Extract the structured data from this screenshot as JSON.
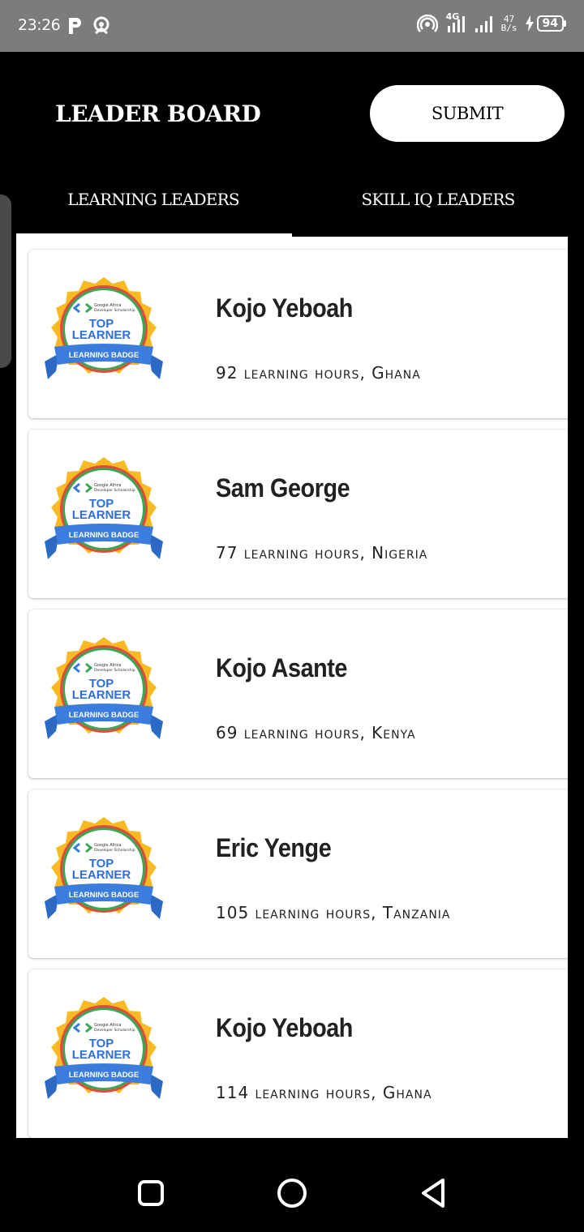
{
  "status_bar": {
    "time": "23:26",
    "net_speed_top": "47",
    "net_speed_bottom": "B/s",
    "network_label": "4G",
    "battery": "94"
  },
  "header": {
    "title": "LEADER BOARD",
    "submit_label": "SUBMIT"
  },
  "tabs": [
    {
      "label": "LEARNING LEADERS",
      "selected": true
    },
    {
      "label": "SKILL IQ LEADERS",
      "selected": false
    }
  ],
  "badge": {
    "brand_line1": "Google Africa",
    "brand_line2": "Developer Scholarship",
    "title_line1": "TOP",
    "title_line2": "LEARNER",
    "ribbon": "LEARNING BADGE"
  },
  "leaders": [
    {
      "name": "Kojo Yeboah",
      "detail": "92 learning hours, Ghana"
    },
    {
      "name": "Sam George",
      "detail": "77 learning hours, Nigeria"
    },
    {
      "name": "Kojo Asante",
      "detail": "69 learning hours, Kenya"
    },
    {
      "name": "Eric Yenge",
      "detail": "105 learning hours, Tanzania"
    },
    {
      "name": "Kojo Yeboah",
      "detail": "114 learning hours, Ghana"
    }
  ],
  "colors": {
    "badge_gold": "#f7b924",
    "badge_ribbon": "#3b7ddd",
    "badge_text": "#2f6fd6",
    "ring_red": "#e04b3c",
    "ring_green": "#3aa757"
  }
}
